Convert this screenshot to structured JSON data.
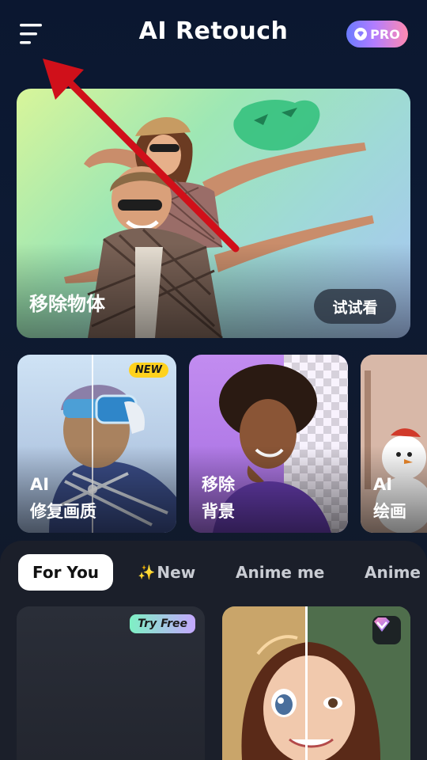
{
  "header": {
    "title": "AI Retouch",
    "pro_label": "PRO",
    "menu_icon": "hamburger-menu-icon"
  },
  "hero": {
    "title": "移除物体",
    "button": "试试看"
  },
  "cards": [
    {
      "line1": "AI",
      "line2": "修复画质",
      "badge": "NEW"
    },
    {
      "line1": "移除",
      "line2": "背景"
    },
    {
      "line1": "AI",
      "line2": "绘画"
    }
  ],
  "tabs": [
    {
      "label": "For You",
      "active": true
    },
    {
      "label": "New",
      "icon": "sparkle-icon"
    },
    {
      "label": "Anime me"
    },
    {
      "label": "Anime"
    }
  ],
  "tiles": {
    "try_free": "Try Free"
  },
  "colors": {
    "background": "#0b1730",
    "sheet": "#1b1f2a",
    "pro_gradient": [
      "#6a7bff",
      "#b27dff",
      "#ff8ab0"
    ],
    "new_badge": "#ffd21e",
    "annotation_arrow": "#d0101a"
  }
}
